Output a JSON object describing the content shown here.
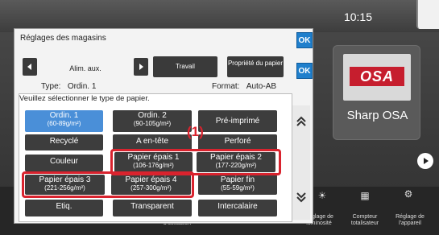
{
  "home": {
    "clock": "10:15",
    "tile_title": "Sharp OSA",
    "logo_text": "OSA",
    "bottom_items": [
      {
        "label": "d'utilisation"
      },
      {
        "label": "Réglage de luminosité"
      },
      {
        "label": "Compteur totalisateur"
      },
      {
        "label": "Réglage de l'appareil"
      }
    ]
  },
  "dialog": {
    "title": "Réglages des magasins",
    "ok_label": "OK",
    "tray_label": "Alim. aux.",
    "tab_travail": "Travail",
    "tab_propriete": "Propriété du papier",
    "type_label": "Type:",
    "type_value": "Ordin. 1",
    "format_label": "Format:",
    "format_value": "Auto-AB",
    "instruction": "Veuillez sélectionner le type de papier.",
    "callout": "(1)"
  },
  "paper_types": [
    {
      "l1": "Ordin. 1",
      "l2": "(60-89g/m²)",
      "selected": true
    },
    {
      "l1": "Ordin. 2",
      "l2": "(90-105g/m²)"
    },
    {
      "l1": "Pré-imprimé",
      "l2": ""
    },
    {
      "l1": "Recyclé",
      "l2": ""
    },
    {
      "l1": "A en-tête",
      "l2": ""
    },
    {
      "l1": "Perforé",
      "l2": ""
    },
    {
      "l1": "Couleur",
      "l2": ""
    },
    {
      "l1": "Papier épais 1",
      "l2": "(106-176g/m²)"
    },
    {
      "l1": "Papier épais 2",
      "l2": "(177-220g/m²)"
    },
    {
      "l1": "Papier épais 3",
      "l2": "(221-256g/m²)"
    },
    {
      "l1": "Papier épais 4",
      "l2": "(257-300g/m²)"
    },
    {
      "l1": "Papier fin",
      "l2": "(55-59g/m²)"
    },
    {
      "l1": "Etiq.",
      "l2": ""
    },
    {
      "l1": "Transparent",
      "l2": ""
    },
    {
      "l1": "Intercalaire",
      "l2": ""
    }
  ],
  "colors": {
    "accent": "#1f7fcc",
    "selected": "#4a8fd8",
    "highlight": "#d9232e"
  }
}
